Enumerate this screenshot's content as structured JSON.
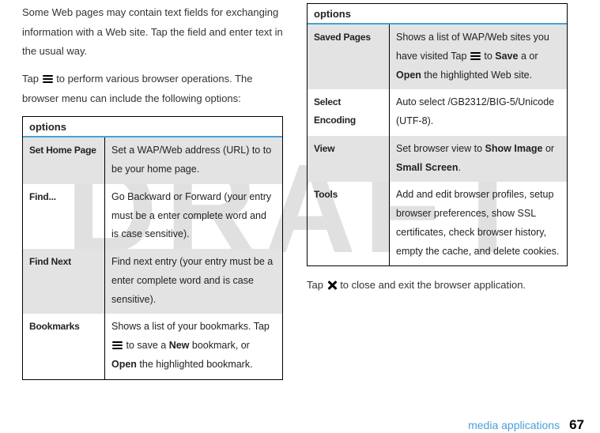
{
  "watermark": "DRAFT",
  "leftCol": {
    "para1": "Some Web pages may contain text fields for exchanging information with a Web site. Tap the field and enter text in the usual way.",
    "para2_pre": "Tap ",
    "para2_post": " to perform various browser operations. The browser menu can include the following options:"
  },
  "leftTable": {
    "header": "options",
    "rows": [
      {
        "label": "Set Home Page",
        "shade": true,
        "descParts": [
          {
            "t": "Set a WAP/Web address (URL) to to be your home page."
          }
        ]
      },
      {
        "label": "Find...",
        "shade": false,
        "descParts": [
          {
            "t": "Go Backward or Forward (your entry must be a enter complete word and is case sensitive)."
          }
        ]
      },
      {
        "label": "Find Next",
        "shade": true,
        "descParts": [
          {
            "t": "Find next entry (your entry must be a enter complete word and is case sensitive)."
          }
        ]
      },
      {
        "label": "Bookmarks",
        "shade": false,
        "descParts": [
          {
            "t": "Shows a list of your bookmarks. Tap "
          },
          {
            "icon": "menu"
          },
          {
            "t": " to save a "
          },
          {
            "b": "New"
          },
          {
            "t": " bookmark, or "
          },
          {
            "b": "Open"
          },
          {
            "t": " the highlighted bookmark."
          }
        ]
      }
    ]
  },
  "rightTable": {
    "header": "options",
    "rows": [
      {
        "label": "Saved Pages",
        "shade": true,
        "descParts": [
          {
            "t": "Shows a list of WAP/Web sites you have visited Tap "
          },
          {
            "icon": "menu"
          },
          {
            "t": " to "
          },
          {
            "b": "Save"
          },
          {
            "t": " a or "
          },
          {
            "b": "Open"
          },
          {
            "t": " the highlighted Web site."
          }
        ]
      },
      {
        "label": "Select Encoding",
        "shade": false,
        "descParts": [
          {
            "t": "Auto select /GB2312/BIG-5/Unicode (UTF-8)."
          }
        ]
      },
      {
        "label": "View",
        "shade": true,
        "descParts": [
          {
            "t": "Set browser view to "
          },
          {
            "b": "Show Image"
          },
          {
            "t": " or "
          },
          {
            "b": "Small Screen"
          },
          {
            "t": "."
          }
        ]
      },
      {
        "label": "Tools",
        "shade": false,
        "descParts": [
          {
            "t": "Add and edit browser profiles, setup browser preferences, show SSL certificates, check browser history, empty the cache, and delete cookies."
          }
        ]
      }
    ]
  },
  "rightCol": {
    "closing_pre": "Tap ",
    "closing_post": " to close and exit the browser application."
  },
  "footer": {
    "section": "media applications",
    "pageNumber": "67"
  }
}
